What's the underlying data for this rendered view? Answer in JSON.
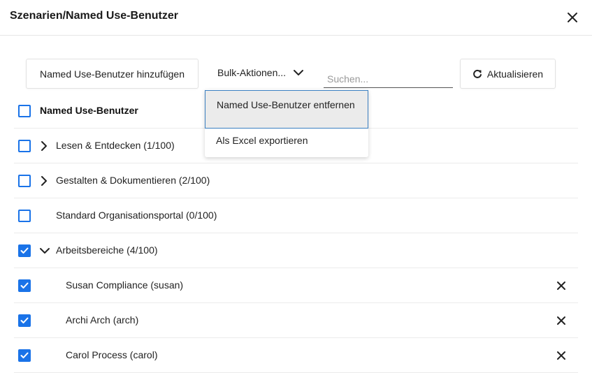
{
  "dialog": {
    "title": "Szenarien/Named Use-Benutzer"
  },
  "toolbar": {
    "add_label": "Named Use-Benutzer hinzufügen",
    "bulk_label": "Bulk-Aktionen...",
    "search_placeholder": "Suchen...",
    "refresh_label": "Aktualisieren"
  },
  "bulk_menu": {
    "items": [
      {
        "label": "Named Use-Benutzer entfernen"
      },
      {
        "label": "Als Excel exportieren"
      }
    ]
  },
  "table": {
    "header_label": "Named Use-Benutzer",
    "rows": [
      {
        "label": "Lesen & Entdecken (1/100)",
        "checked": false,
        "expander": "collapsed"
      },
      {
        "label": "Gestalten & Dokumentieren (2/100)",
        "checked": false,
        "expander": "collapsed"
      },
      {
        "label": "Standard Organisationsportal (0/100)",
        "checked": false,
        "expander": "none"
      },
      {
        "label": "Arbeitsbereiche (4/100)",
        "checked": true,
        "expander": "expanded"
      },
      {
        "label": "Susan Compliance (susan)",
        "checked": true,
        "child": true
      },
      {
        "label": "Archi Arch (arch)",
        "checked": true,
        "child": true
      },
      {
        "label": "Carol Process (carol)",
        "checked": true,
        "child": true
      }
    ]
  },
  "colors": {
    "accent": "#1a73e8",
    "menu_focus_border": "#3a7fc1",
    "menu_focus_bg": "#ebebeb"
  }
}
